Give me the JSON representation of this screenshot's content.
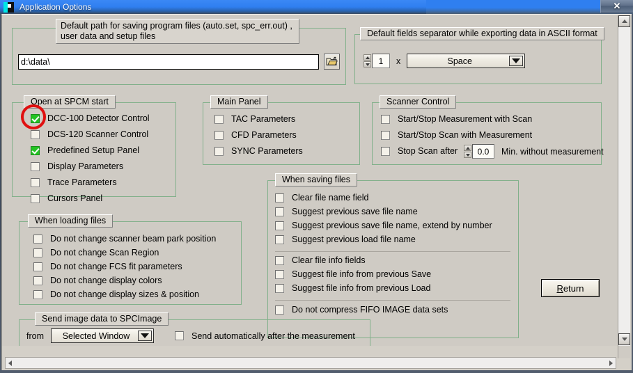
{
  "window": {
    "title": "Application Options",
    "close_label": "✕",
    "app_icon": "spcm-app-icon"
  },
  "default_path": {
    "legend": "Default path for saving program files (auto.set, spc_err.out) , user data and setup files",
    "value": "d:\\data\\",
    "browse_icon": "open-folder-icon"
  },
  "ascii_separator": {
    "legend": "Default fields separator while exporting data in ASCII format",
    "count": "1",
    "multiplier_label": "x",
    "separator_selected": "Space"
  },
  "open_at_start": {
    "legend": "Open at SPCM start",
    "items": [
      {
        "label": "DCC-100 Detector Control",
        "checked": true,
        "highlighted": true
      },
      {
        "label": "DCS-120 Scanner Control",
        "checked": false,
        "highlighted": false
      },
      {
        "label": "Predefined Setup Panel",
        "checked": true,
        "highlighted": false
      },
      {
        "label": "Display Parameters",
        "checked": false,
        "highlighted": false
      },
      {
        "label": "Trace Parameters",
        "checked": false,
        "highlighted": false
      },
      {
        "label": "Cursors Panel",
        "checked": false,
        "highlighted": false
      }
    ]
  },
  "main_panel": {
    "legend": "Main Panel",
    "items": [
      {
        "label": "TAC Parameters",
        "checked": false
      },
      {
        "label": "CFD Parameters",
        "checked": false
      },
      {
        "label": "SYNC Parameters",
        "checked": false
      }
    ]
  },
  "scanner_control": {
    "legend": "Scanner Control",
    "items": [
      {
        "label": "Start/Stop  Measurement with Scan",
        "checked": false
      },
      {
        "label": "Start/Stop Scan with  Measurement",
        "checked": false
      },
      {
        "label": "Stop Scan after",
        "checked": false
      }
    ],
    "stop_scan_value": "0.0",
    "stop_scan_suffix": "Min. without measurement"
  },
  "when_saving": {
    "legend": "When saving files",
    "items": [
      {
        "label": "Clear file name field",
        "checked": false
      },
      {
        "label": "Suggest  previous save file name",
        "checked": false
      },
      {
        "label": "Suggest  previous save file name, extend by number",
        "checked": false
      },
      {
        "label": "Suggest  previous load file name",
        "checked": false
      },
      {
        "label": "Clear file info fields",
        "checked": false
      },
      {
        "label": "Suggest  file info from previous Save",
        "checked": false
      },
      {
        "label": "Suggest  file info from previous Load",
        "checked": false
      },
      {
        "label": "Do not compress FIFO IMAGE data sets",
        "checked": false
      }
    ]
  },
  "when_loading": {
    "legend": "When loading files",
    "items": [
      {
        "label": "Do not change scanner beam park position",
        "checked": false
      },
      {
        "label": "Do not change Scan Region",
        "checked": false
      },
      {
        "label": "Do not change FCS fit parameters",
        "checked": false
      },
      {
        "label": "Do not change display colors",
        "checked": false
      },
      {
        "label": "Do not change display sizes & position",
        "checked": false
      }
    ]
  },
  "send_image": {
    "legend": "Send image data to SPCImage",
    "from_label": "from",
    "source_selected": "Selected Window",
    "auto_send_label": "Send automatically after the measurement",
    "auto_send_checked": false
  },
  "return_button": {
    "accel": "R",
    "rest": "eturn"
  },
  "scrollbars": {
    "v_up": "scroll-up-arrow",
    "v_down": "scroll-down-arrow",
    "h_left": "scroll-left-arrow",
    "h_right": "scroll-right-arrow"
  },
  "colors": {
    "group_border": "#81b08a",
    "checkbox_checked": "#22c322",
    "annotation": "#e01010",
    "dialog_bg": "#cfcbc4",
    "titlebar": "#2f7ff0"
  }
}
